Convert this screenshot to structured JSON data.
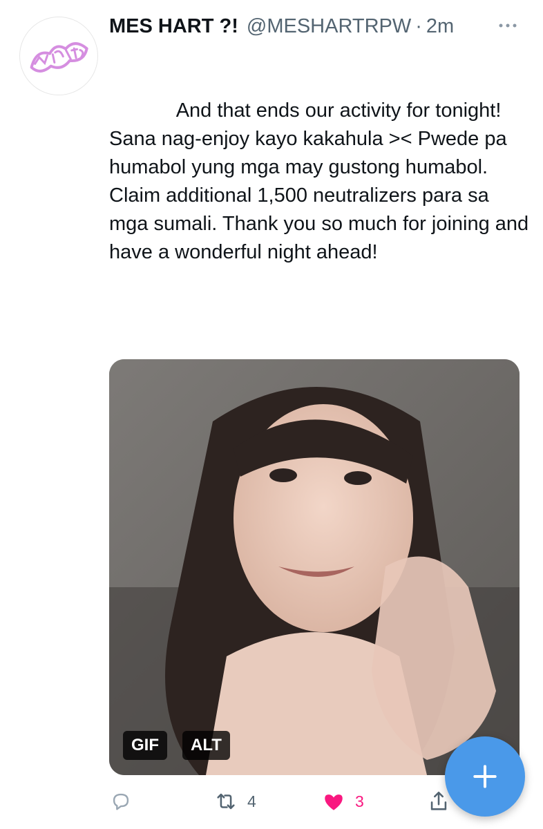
{
  "tweet": {
    "display_name": "MES HART ?!",
    "handle": "@MESHARTRPW",
    "separator": "·",
    "time": "2m",
    "avatar_logo_text": "MES HART",
    "text": "            And that ends our activity for tonight! Sana nag-enjoy kayo kakahula >< Pwede pa humabol yung mga may gustong humabol. Claim additional 1,500 neutralizers para sa mga sumali. Thank you so much for joining and have a wonderful night ahead!",
    "media": {
      "gif_label": "GIF",
      "alt_label": "ALT"
    },
    "actions": {
      "reply_count": "",
      "retweet_count": "4",
      "like_count": "3"
    }
  },
  "colors": {
    "accent": "#4a99e9",
    "like": "#f91880",
    "secondary_text": "#536471",
    "avatar_logo": "#d58ee0"
  },
  "icons": {
    "more": "more-horizontal-icon",
    "reply": "reply-icon",
    "retweet": "retweet-icon",
    "like": "heart-filled-icon",
    "share": "share-icon",
    "compose": "plus-icon"
  }
}
